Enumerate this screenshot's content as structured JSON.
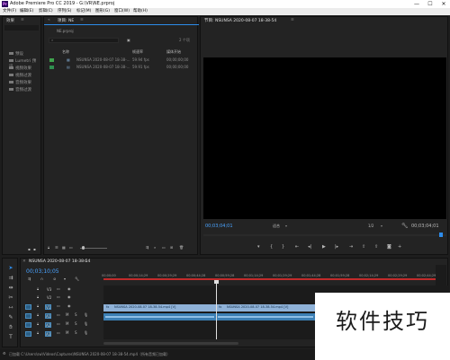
{
  "window": {
    "title": "Adobe Premiere Pro CC 2019 - G:\\VR\\NE.prproj",
    "app_icon": "Pr",
    "min": "—",
    "max": "☐",
    "close": "✕"
  },
  "menu": [
    "文件(F)",
    "编辑(E)",
    "剪辑(C)",
    "序列(S)",
    "标记(M)",
    "图形(G)",
    "窗口(W)",
    "帮助(H)"
  ],
  "effects_panel": {
    "tab": "效果",
    "menu_icon": "≡",
    "items": [
      "预设",
      "Lumetri 预设",
      "视频效果",
      "视频过渡",
      "音频效果",
      "音频过渡"
    ]
  },
  "project_panel": {
    "tab": "项目: NE",
    "menu_icon": "≡",
    "project_file": "NE.prproj",
    "item_count": "2 个项",
    "search_placeholder": "",
    "columns": [
      "名称",
      "帧速率",
      "媒体开始"
    ],
    "rows": [
      {
        "name": "NSUNSA 2020-08-07 18-38-...",
        "fps": "59.94 fps",
        "start": "00;00;00;00",
        "color": "#3fa34d"
      },
      {
        "name": "NSUNSA 2020-08-07 18-38-...",
        "fps": "59.91 fps",
        "start": "00;00;00;00",
        "color": "#2f8f4f"
      }
    ]
  },
  "program_monitor": {
    "tab": "节目: NSUNSA 2020-08-07 18-38-54",
    "menu_icon": "≡",
    "timecode_left": "00;03;04;01",
    "fit": "适合",
    "quality": "1/2",
    "timecode_right": "00;03;04;01"
  },
  "timeline": {
    "tab": "NSUNSA 2020-08-07 18-38-54",
    "menu_icon": "≡",
    "timecode": "00;03;10;05",
    "ruler": [
      "00;00;00",
      "00;00;14;29",
      "00;00;29;29",
      "00;00;44;28",
      "00;00;59;28",
      "00;01;14;29",
      "00;01;29;29",
      "00;01;44;28",
      "00;01;59;28",
      "00;02;14;29",
      "00;02;29;29",
      "00;02;44;29"
    ],
    "video_tracks": [
      "V3",
      "V2",
      "V1"
    ],
    "audio_tracks": [
      "A1",
      "A2",
      "A3"
    ],
    "clip_label_1": "NSUNSA 2020-08-07 18-38-54.mp4 [V]",
    "clip_label_2": "NSUNSA 2020-08-07 18-38-54.mp4 [V]",
    "fx_badge": "fx"
  },
  "status_bar": {
    "text": "已加载 C:\\Users\\sw\\Videos\\Captures\\NSUNSA 2020-08-07 18-38-54.mp4（所有音频已加载）"
  },
  "watermark": {
    "text": "软件技巧"
  },
  "colors": {
    "accent": "#2d8ceb",
    "timecode": "#4aa3ff",
    "video_clip": "#8fb2d8",
    "audio_clip": "#3c7fb4",
    "playhead_bar": "#c22b2b"
  }
}
